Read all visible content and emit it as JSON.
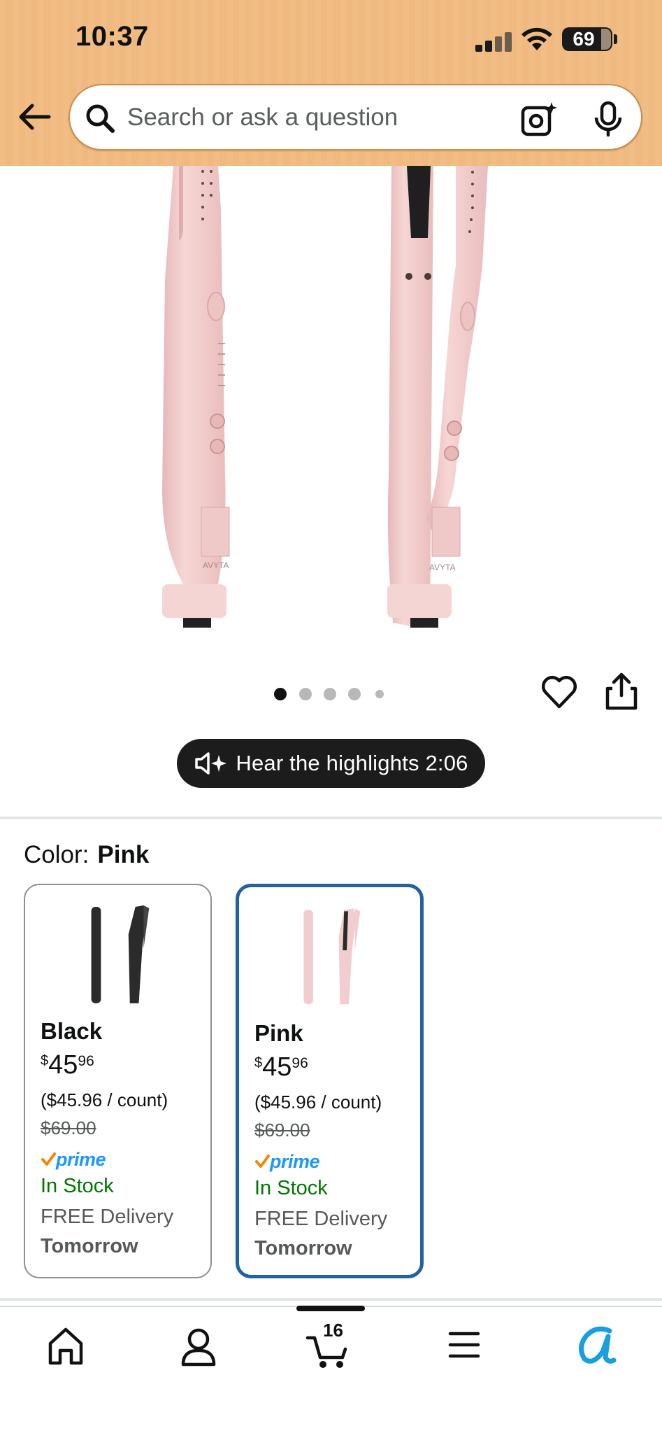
{
  "status_bar": {
    "time": "10:37",
    "battery": "69"
  },
  "search": {
    "placeholder": "Search or ask a question"
  },
  "carousel": {
    "dot_count": 5,
    "active_index": 0
  },
  "audio": {
    "label": "Hear the highlights 2:06"
  },
  "color_selector": {
    "label": "Color:",
    "selected": "Pink",
    "options": [
      {
        "name": "Black",
        "currency": "$",
        "whole": "45",
        "cents": "96",
        "unit_price": "($45.96 / count)",
        "list_price": "$69.00",
        "prime": "prime",
        "stock": "In Stock",
        "delivery": "FREE Delivery",
        "delivery_day": "Tomorrow",
        "swatch_color": "#2b2b2b"
      },
      {
        "name": "Pink",
        "currency": "$",
        "whole": "45",
        "cents": "96",
        "unit_price": "($45.96 / count)",
        "list_price": "$69.00",
        "prime": "prime",
        "stock": "In Stock",
        "delivery": "FREE Delivery",
        "delivery_day": "Tomorrow",
        "swatch_color": "#f2cdcf"
      }
    ]
  },
  "bottom_nav": {
    "cart_count": "16",
    "items": [
      "home-icon",
      "account-icon",
      "cart-icon",
      "menu-icon",
      "rufus-icon"
    ]
  },
  "colors": {
    "header_bg": "#f1bd84",
    "selected_border": "#2162a1",
    "in_stock": "#007600",
    "prime_blue": "#1a98ff",
    "prime_check": "#f08804"
  }
}
